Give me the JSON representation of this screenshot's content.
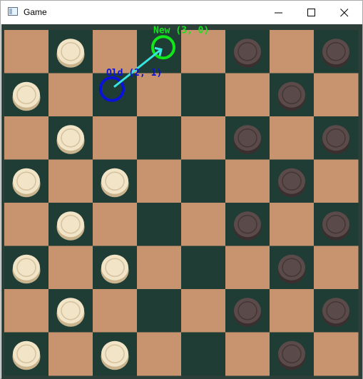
{
  "window": {
    "title": "Game"
  },
  "icons": {
    "app": "window-app-icon",
    "minimize": "minimize-icon",
    "maximize": "maximize-icon",
    "close": "close-icon"
  },
  "board": {
    "rows": 8,
    "cols": 8,
    "colors": {
      "light": "#c89470",
      "dark": "#1f3d35",
      "frame": "#2c3f38"
    },
    "pieces": {
      "colors": {
        "cream": "#f1e4c7",
        "cream_edge": "#c9b48e",
        "brown": "#5b4a4a",
        "brown_edge": "#3b2e2e"
      },
      "cream": [
        [
          1,
          0
        ],
        [
          0,
          1
        ],
        [
          1,
          2
        ],
        [
          0,
          3
        ],
        [
          2,
          3
        ],
        [
          1,
          4
        ],
        [
          0,
          5
        ],
        [
          2,
          5
        ],
        [
          1,
          6
        ],
        [
          0,
          7
        ],
        [
          2,
          7
        ]
      ],
      "brown": [
        [
          5,
          0
        ],
        [
          7,
          0
        ],
        [
          6,
          1
        ],
        [
          5,
          2
        ],
        [
          7,
          2
        ],
        [
          6,
          3
        ],
        [
          5,
          4
        ],
        [
          7,
          4
        ],
        [
          6,
          5
        ],
        [
          5,
          6
        ],
        [
          7,
          6
        ],
        [
          6,
          7
        ]
      ]
    },
    "move": {
      "old": {
        "col": 2,
        "row": 1,
        "label": "Old (2, 1)",
        "color": "#0a12d8"
      },
      "new": {
        "col": 3,
        "row": 0,
        "label": "New (3, 0)",
        "color": "#12e61a"
      },
      "arrow_color": "#38e6e0"
    }
  }
}
